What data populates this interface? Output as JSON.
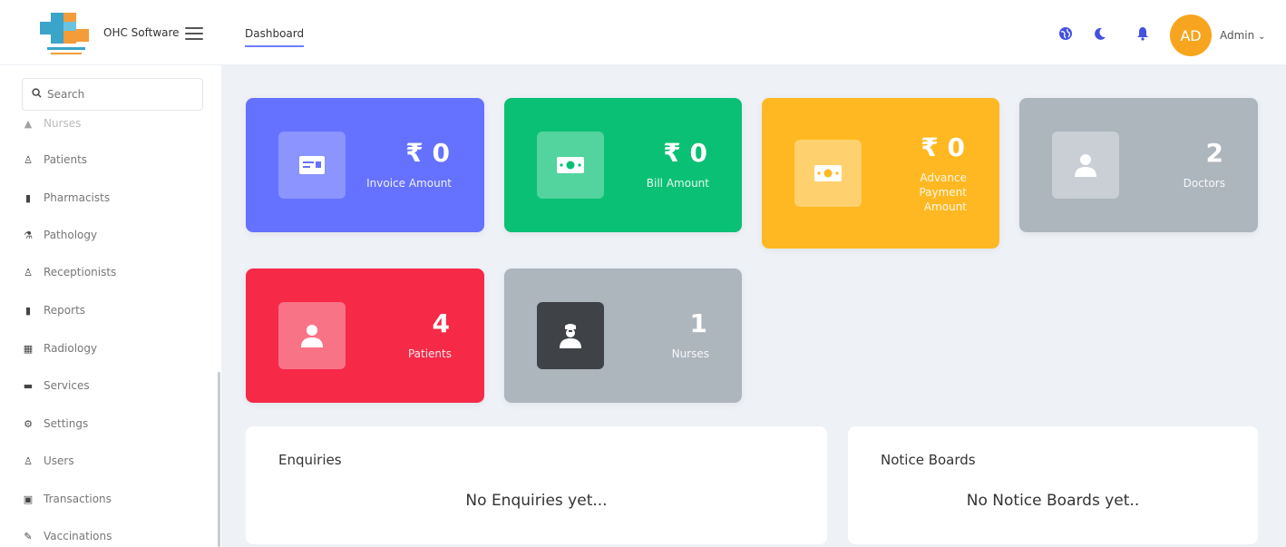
{
  "header": {
    "brand": "OHC Software",
    "nav_tab": "Dashboard",
    "avatar_initials": "AD",
    "user_label": "Admin",
    "icons": [
      "globe-icon",
      "moon-icon",
      "bell-icon"
    ]
  },
  "sidebar": {
    "search_placeholder": "Search",
    "items": [
      {
        "label": "Nurses",
        "icon": "nurse-icon"
      },
      {
        "label": "Patients",
        "icon": "user-icon"
      },
      {
        "label": "Pharmacists",
        "icon": "file-icon"
      },
      {
        "label": "Pathology",
        "icon": "flask-icon"
      },
      {
        "label": "Receptionists",
        "icon": "user-tie-icon"
      },
      {
        "label": "Reports",
        "icon": "file-icon"
      },
      {
        "label": "Radiology",
        "icon": "x-ray-icon"
      },
      {
        "label": "Services",
        "icon": "briefcase-icon"
      },
      {
        "label": "Settings",
        "icon": "gears-icon"
      },
      {
        "label": "Users",
        "icon": "users-icon"
      },
      {
        "label": "Transactions",
        "icon": "money-icon"
      },
      {
        "label": "Vaccinations",
        "icon": "syringe-icon"
      }
    ]
  },
  "cards": [
    {
      "value": "₹ 0",
      "label": "Invoice Amount",
      "color": "#6571ff",
      "icon": "invoice-icon"
    },
    {
      "value": "₹ 0",
      "label": "Bill Amount",
      "color": "#0ac074",
      "icon": "money-bill-icon"
    },
    {
      "value": "₹ 0",
      "label": "Advance Payment Amount",
      "color": "#ffb821",
      "icon": "money-bill-icon"
    },
    {
      "value": "2",
      "label": "Doctors",
      "color": "#adb5bd",
      "icon": "user-icon"
    },
    {
      "value": "4",
      "label": "Patients",
      "color": "#f62947",
      "icon": "user-icon"
    },
    {
      "value": "1",
      "label": "Nurses",
      "color": "#adb5bd",
      "icon": "nurse-icon"
    }
  ],
  "panels": {
    "enquiries": {
      "title": "Enquiries",
      "empty": "No Enquiries yet..."
    },
    "notice_boards": {
      "title": "Notice Boards",
      "empty": "No Notice Boards yet.."
    }
  }
}
